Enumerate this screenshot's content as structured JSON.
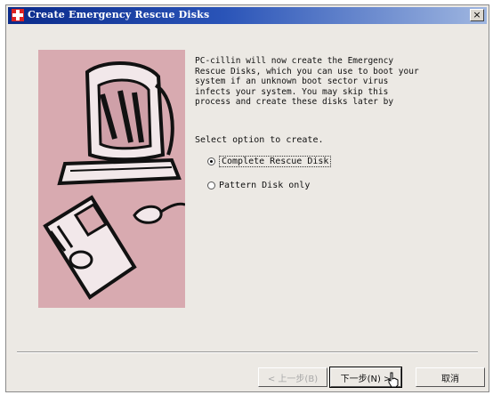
{
  "window": {
    "title": "Create Emergency Rescue Disks",
    "close_label": "×"
  },
  "description": "PC-cillin will now create the Emergency\nRescue Disks, which you can use to boot your\nsystem if an unknown boot sector virus\ninfects your system. You may skip this\nprocess and create these disks later by",
  "select_label": "Select option to create.",
  "options": [
    {
      "label": "Complete Rescue Disk",
      "selected": true
    },
    {
      "label": "Pattern Disk only",
      "selected": false
    }
  ],
  "buttons": {
    "back": "< 上一步(B)",
    "next": "下一步(N) >",
    "cancel": "取消"
  },
  "colors": {
    "illustration_bg": "#d8aab0",
    "title_bar": "#0a2a8a"
  }
}
